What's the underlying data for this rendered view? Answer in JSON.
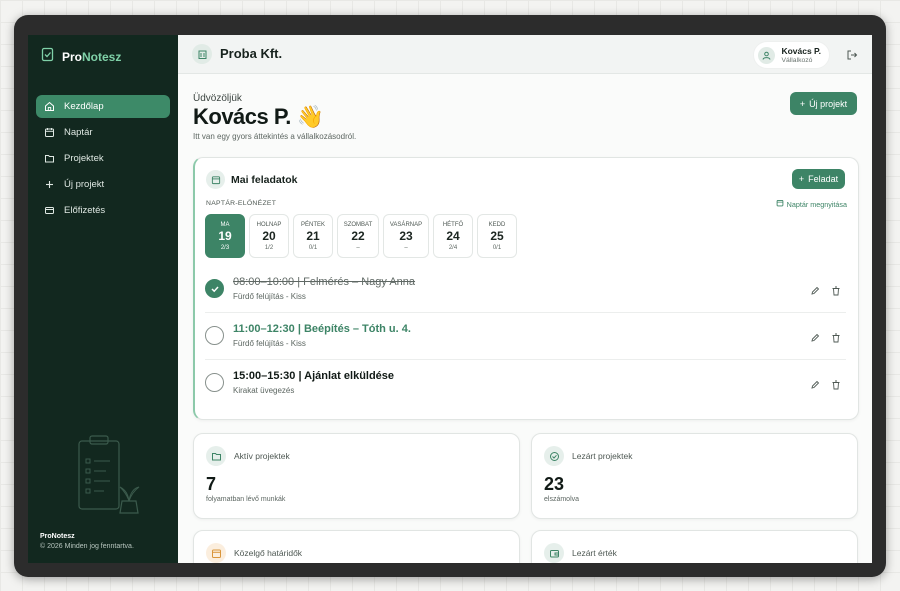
{
  "brand": {
    "name_part1": "Pro",
    "name_part2": "Notesz"
  },
  "sidebar": {
    "items": [
      {
        "label": "Kezdőlap",
        "icon": "home-icon",
        "active": true
      },
      {
        "label": "Naptár",
        "icon": "calendar-icon"
      },
      {
        "label": "Projektek",
        "icon": "folder-icon"
      },
      {
        "label": "Új projekt",
        "icon": "plus-icon"
      },
      {
        "label": "Előfizetés",
        "icon": "credit-card-icon"
      }
    ],
    "footer_title": "ProNotesz",
    "footer_copy": "© 2026 Minden jog fenntartva."
  },
  "header": {
    "company": "Proba Kft.",
    "user_name": "Kovács P.",
    "user_role": "Vállalkozó"
  },
  "main": {
    "welcome": "Üdvözöljük",
    "user_big": "Kovács P. 👋",
    "subtitle": "Itt van egy gyors áttekintés a vállalkozásodról.",
    "new_project_label": "Új projekt"
  },
  "tasks": {
    "title": "Mai feladatok",
    "add_label": "Feladat",
    "calendar_label": "NAPTÁR-ELŐNÉZET",
    "calendar_open": "Naptár megnyitása",
    "days": [
      {
        "name": "MA",
        "date": "19",
        "count": "2/3"
      },
      {
        "name": "HOLNAP",
        "date": "20",
        "count": "1/2"
      },
      {
        "name": "PÉNTEK",
        "date": "21",
        "count": "0/1"
      },
      {
        "name": "SZOMBAT",
        "date": "22",
        "count": "–"
      },
      {
        "name": "VASÁRNAP",
        "date": "23",
        "count": "–"
      },
      {
        "name": "HÉTFŐ",
        "date": "24",
        "count": "2/4"
      },
      {
        "name": "KEDD",
        "date": "25",
        "count": "0/1"
      }
    ],
    "items": [
      {
        "title": "08:00–10:00 | Felmérés – Nagy Anna",
        "sub": "Fürdő felújítás - Kiss",
        "status": "done"
      },
      {
        "title": "11:00–12:30 | Beépítés – Tóth u. 4.",
        "sub": "Fürdő felújítás - Kiss",
        "status": "current"
      },
      {
        "title": "15:00–15:30 | Ajánlat elküldése",
        "sub": "Kirakat üvegezés",
        "status": "open"
      }
    ]
  },
  "stats": [
    {
      "label": "Aktív projektek",
      "value": "7",
      "sub": "folyamatban lévő munkák",
      "icon": "folder-icon"
    },
    {
      "label": "Lezárt projektek",
      "value": "23",
      "sub": "elszámolva",
      "icon": "check-circle-icon"
    },
    {
      "label": "Közelgő határidők",
      "value": "",
      "sub": "",
      "icon": "calendar-icon"
    },
    {
      "label": "Lezárt érték",
      "value": "",
      "sub": "",
      "icon": "wallet-icon"
    }
  ]
}
